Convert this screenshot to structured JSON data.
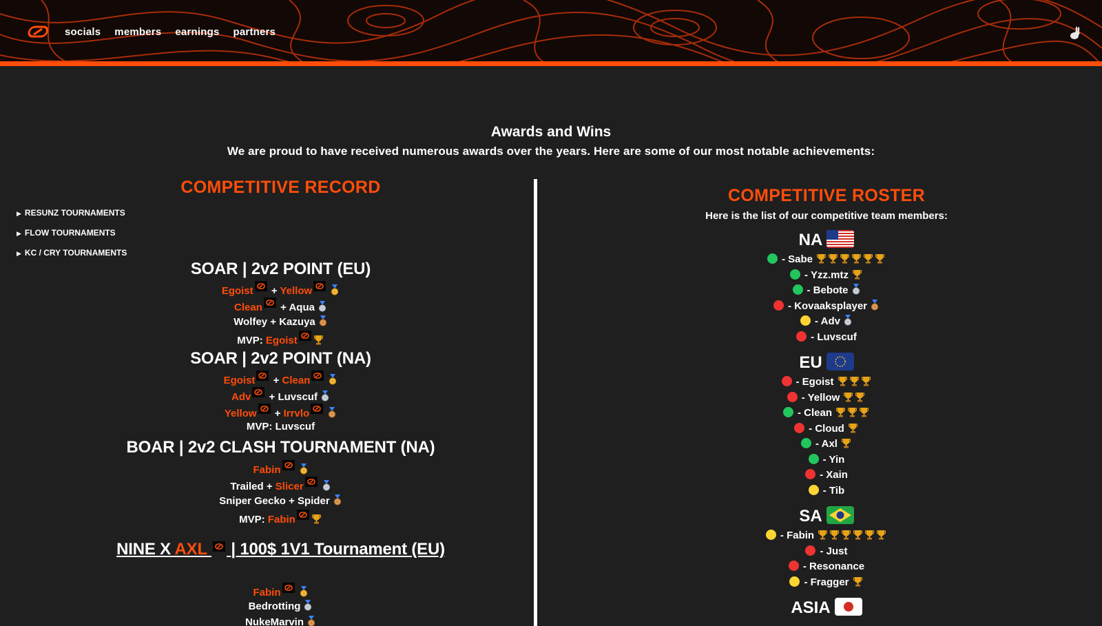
{
  "nav": {
    "links": [
      "socials",
      "members",
      "earnings",
      "partners"
    ]
  },
  "awards": {
    "title": "Awards and Wins",
    "subtitle": "We are proud to have received numerous awards over the years. Here are some of our most notable achievements:"
  },
  "record": {
    "heading": "COMPETITIVE RECORD",
    "dropdowns": [
      "RESUNZ TOURNAMENTS",
      "FLOW TOURNAMENTS",
      "KC / CRY TOURNAMENTS"
    ],
    "ev1": {
      "title": "SOAR | 2v2 POINT (EU)",
      "a": "Egoist",
      "b": "Yellow",
      "c": "Clean",
      "d": "+ Aqua",
      "e": "Wolfey + Kazuya",
      "mvp": "MVP:",
      "mvp_name": "Egoist"
    },
    "ev2": {
      "title": "SOAR | 2v2 POINT (NA)",
      "a": "Egoist",
      "b": "Clean",
      "c": "Adv",
      "d": "+ Luvscuf",
      "e": "Yellow",
      "f": "Irrvlo",
      "mvp": "MVP: Luvscuf"
    },
    "ev3": {
      "title": "BOAR | 2v2 CLASH TOURNAMENT (NA)",
      "a": "Fabin",
      "b": "Trailed +",
      "c": "Slicer",
      "d": "Sniper Gecko + Spider",
      "mvp": "MVP:",
      "mvp_name": "Fabin"
    },
    "ev4": {
      "t1": "NINE X",
      "t2": "AXL",
      "t3": "| 100$ 1V1 Tournament (EU)",
      "a": "Fabin",
      "b": "Bedrotting",
      "c": "NukeMarvin"
    },
    "plus": "+"
  },
  "roster": {
    "heading": "COMPETITIVE ROSTER",
    "subtitle": "Here is the list of our competitive team members:",
    "regions": [
      {
        "name": "NA",
        "members": [
          {
            "name": "- Sabe",
            "status": "green",
            "trophies": 6
          },
          {
            "name": "- Yzz.mtz",
            "status": "green",
            "trophies": 1
          },
          {
            "name": "- Bebote",
            "status": "green",
            "medal": "silver"
          },
          {
            "name": "- Kovaaksplayer",
            "status": "red",
            "medal": "bronze"
          },
          {
            "name": "- Adv",
            "status": "yellow",
            "medal": "silver"
          },
          {
            "name": "- Luvscuf",
            "status": "red"
          }
        ]
      },
      {
        "name": "EU",
        "members": [
          {
            "name": "- Egoist",
            "status": "red",
            "trophies": 3
          },
          {
            "name": "- Yellow",
            "status": "red",
            "trophies": 2
          },
          {
            "name": "- Clean",
            "status": "green",
            "trophies": 3
          },
          {
            "name": "- Cloud",
            "status": "red",
            "trophies": 1
          },
          {
            "name": "- Axl",
            "status": "green",
            "trophies": 1
          },
          {
            "name": "- Yin",
            "status": "green"
          },
          {
            "name": "- Xain",
            "status": "red"
          },
          {
            "name": "- Tib",
            "status": "yellow"
          }
        ]
      },
      {
        "name": "SA",
        "members": [
          {
            "name": "- Fabin",
            "status": "yellow",
            "trophies": 6
          },
          {
            "name": "- Just",
            "status": "red"
          },
          {
            "name": "- Resonance",
            "status": "red"
          },
          {
            "name": "- Fragger",
            "status": "yellow",
            "trophies": 1
          }
        ]
      },
      {
        "name": "ASIA",
        "members": []
      }
    ]
  },
  "colors": {
    "accent": "#ff4d0a",
    "green": "#22c55e",
    "red": "#ef3333",
    "yellow": "#fcd535",
    "gold": "#e8a317"
  }
}
